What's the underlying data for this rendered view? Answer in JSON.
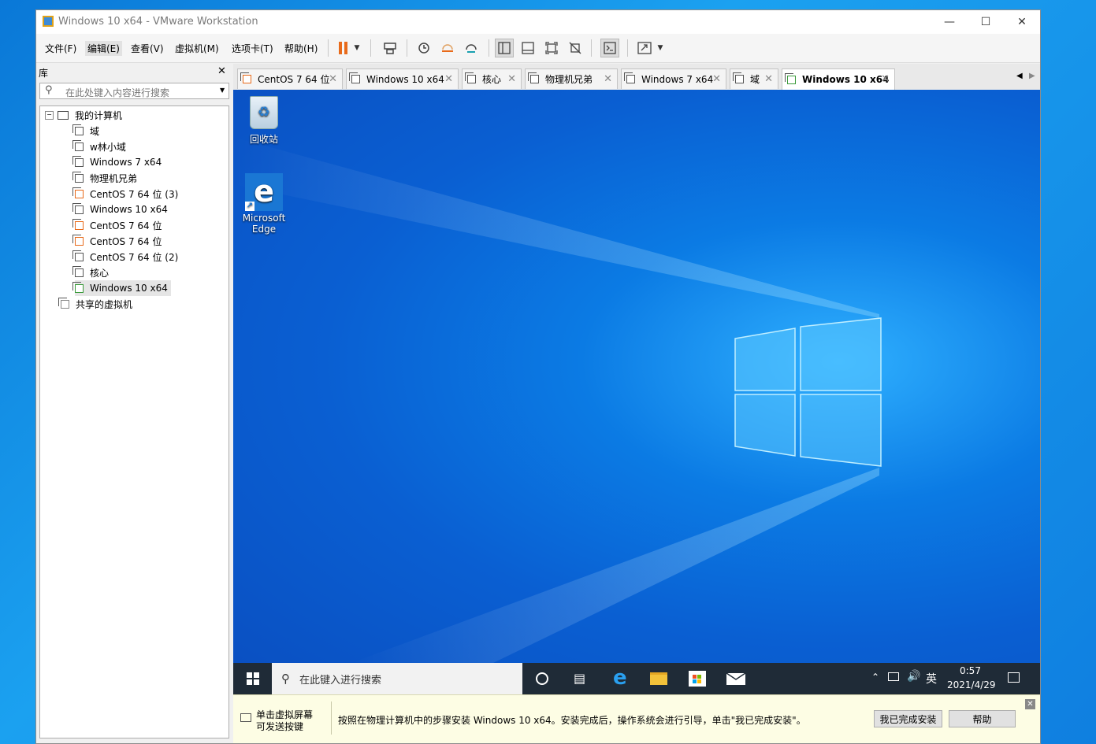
{
  "window": {
    "title": "Windows 10 x64 - VMware Workstation"
  },
  "menu": [
    "文件(F)",
    "编辑(E)",
    "查看(V)",
    "虚拟机(M)",
    "选项卡(T)",
    "帮助(H)"
  ],
  "library": {
    "header": "库",
    "search_placeholder": "在此处键入内容进行搜索",
    "root": "我的计算机",
    "items": [
      "域",
      "w林小域",
      "Windows 7 x64",
      "物理机兄弟",
      "CentOS 7 64 位 (3)",
      "Windows 10 x64",
      "CentOS 7 64 位",
      "CentOS 7 64 位",
      "CentOS 7 64 位 (2)",
      "核心",
      "Windows 10 x64"
    ],
    "shared": "共享的虚拟机"
  },
  "tabs": [
    "CentOS 7 64 位",
    "Windows 10 x64",
    "核心",
    "物理机兄弟",
    "Windows 7 x64",
    "域",
    "Windows 10 x64"
  ],
  "desktop": {
    "icons": [
      "回收站",
      "Microsoft Edge"
    ],
    "taskbar": {
      "search_placeholder": "在此键入进行搜索",
      "ime": "英",
      "time": "0:57",
      "date": "2021/4/29"
    }
  },
  "infobar": {
    "hint_line1": "单击虚拟屏幕",
    "hint_line2": "可发送按键",
    "message": "按照在物理计算机中的步骤安装 Windows 10 x64。安装完成后，操作系统会进行引导，单击\"我已完成安装\"。",
    "done_button": "我已完成安装",
    "help_button": "帮助"
  },
  "colors": {
    "accent_orange": "#e86a1a",
    "desktop_blue": "#0a5fd2",
    "taskbar": "#1f2b37",
    "infobar": "#fdfde4"
  }
}
